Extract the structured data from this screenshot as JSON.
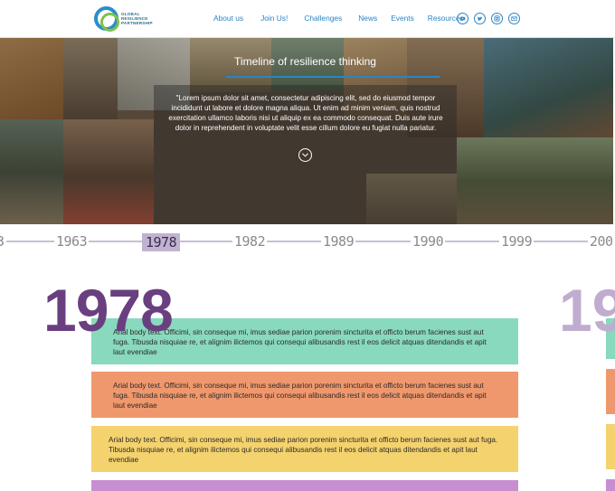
{
  "header": {
    "logo_lines": [
      "GLOBAL",
      "RESILIENCE",
      "PARTNERSHIP"
    ],
    "nav": [
      "About us",
      "Join Us!",
      "Challenges",
      "News",
      "Events",
      "Resources"
    ],
    "social_icons": [
      "youtube-icon",
      "twitter-icon",
      "instagram-icon",
      "email-icon"
    ],
    "link_color": "#2a85c4"
  },
  "hero": {
    "title": "Timeline of resilience thinking",
    "body": "\"Lorem ipsum dolor sit amet, consectetur adipiscing elit, sed do eiusmod tempor incididunt ut labore et dolore magna aliqua. Ut enim ad minim veniam, quis nostrud exercitation ullamco laboris nisi ut aliquip ex ea commodo consequat. Duis aute irure dolor in reprehendent in voluptate velit esse cillum dolore eu fugiat nulla pariatur.",
    "scroll_icon": "chevron-down-icon"
  },
  "timeline": {
    "years": [
      "3",
      "1963",
      "1978",
      "1982",
      "1989",
      "1990",
      "1999",
      "200"
    ],
    "active": "1978"
  },
  "main": {
    "big_year": "1978",
    "next_year_partial": "19",
    "cards": [
      {
        "text": "Arial body text. Officimi, sin conseque mi, imus sediae parion porenim sincturita et officto berum facienes sust aut fuga. Tibusda nisquiae re, et alignim ilictemos qui consequi alibusandis rest il eos delicit atquas ditendandis et apit laut evendiae",
        "color": "#88d9bd"
      },
      {
        "text": "Arial body text. Officimi, sin conseque mi, imus sediae parion porenim sincturita et officto berum facienes sust aut fuga. Tibusda nisquiae re, et alignim ilictemos qui consequi alibusandis rest il eos delicit atquas ditendandis et apit laut evendiae",
        "color": "#f0986d"
      },
      {
        "text": "Arial body text. Officimi, sin conseque mi, imus sediae parion porenim sincturita et officto berum facienes sust aut fuga. Tibusda nisquiae re, et alignim ilictemos qui consequi alibusandis rest il eos delicit atquas ditendandis et apit laut evendiae",
        "color": "#f4d26d"
      },
      {
        "text": "",
        "color": "#c78ed0"
      }
    ],
    "accent_color": "#6a3f80"
  }
}
